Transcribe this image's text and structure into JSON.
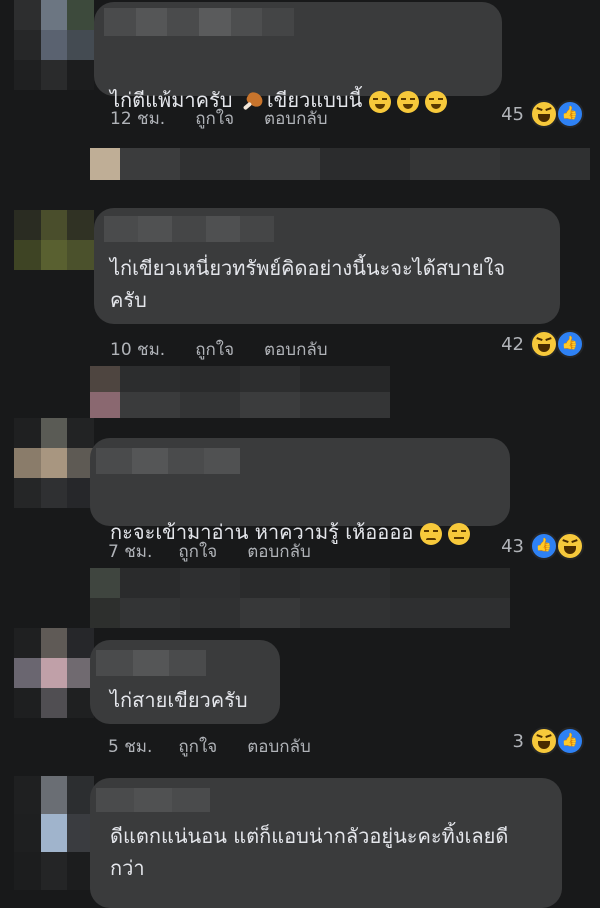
{
  "comments": [
    {
      "text": "ไก่ตีแพ้มาครับ ",
      "text_after": "เขียวแบบนี้ ",
      "time": "12 ชม.",
      "like": "ถูกใจ",
      "reply": "ตอบกลับ",
      "count": "45"
    },
    {
      "text": "ไก่เขียวเหนี่ยวทรัพย์คิดอย่างนี้นะจะได้สบายใจ\nครับ",
      "time": "10 ชม.",
      "like": "ถูกใจ",
      "reply": "ตอบกลับ",
      "count": "42"
    },
    {
      "text": "กะจะเข้ามาอ่าน หาความรู้ เห้ออออ ",
      "time": "7 ชม.",
      "like": "ถูกใจ",
      "reply": "ตอบกลับ",
      "count": "43"
    },
    {
      "text": "ไก่สายเขียวครับ",
      "time": "5 ชม.",
      "like": "ถูกใจ",
      "reply": "ตอบกลับ",
      "count": "3"
    },
    {
      "text": "ดีแตกแน่นอน แต่ก็แอบน่ากลัวอยู่นะคะทิ้งเลยดี\nกว่า"
    }
  ],
  "icons": {
    "drumstick": "poultry-leg-emoji-icon",
    "laugh": "grinning-squinting-emoji-icon",
    "worried": "worried-face-emoji-icon",
    "expressionless": "expressionless-face-emoji-icon",
    "haha_reaction": "haha-reaction-icon",
    "like_reaction": "like-reaction-icon"
  },
  "colors": {
    "background": "#18191a",
    "bubble": "#3a3b3c",
    "text": "#e4e6eb",
    "meta": "#b0b3b8",
    "like_blue": "#2e81f4",
    "haha_yellow": "#f7c93b"
  }
}
